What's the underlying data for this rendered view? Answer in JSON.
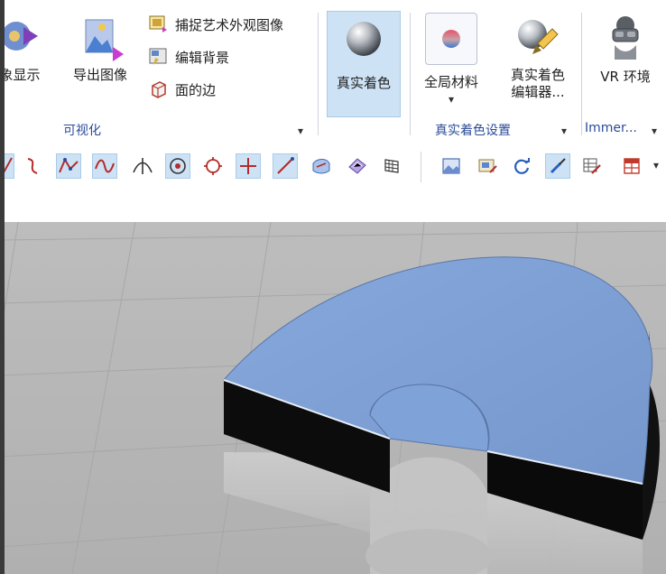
{
  "ribbon": {
    "left_button_partial_label": "象显示",
    "export_image_label": "导出图像",
    "capture_art_label": "捕捉艺术外观图像",
    "edit_background_label": "编辑背景",
    "face_edge_label": "面的边",
    "group_visualize_label": "可视化",
    "true_shading_label": "真实着色",
    "global_material_label": "全局材料",
    "true_shading_editor_label_line1": "真实着色",
    "true_shading_editor_label_line2": "编辑器...",
    "group_true_shading_settings_label": "真实着色设置",
    "vr_env_label": "VR 环境",
    "group_immersive_label": "Immer...",
    "dropdown_glyph": "▾"
  },
  "toolbar": {
    "icons": [
      "curve-partial-icon",
      "s-curve-icon",
      "polyline-icon",
      "spline-icon",
      "intersection-point-icon",
      "point-on-target-icon",
      "circle-center-icon",
      "crosshair-icon",
      "line-pencil-icon",
      "surface-icon",
      "pattern-face-icon",
      "grid-face-icon",
      "view-photo-icon",
      "image-edit-icon",
      "refresh-cycle-icon",
      "brush-select-icon",
      "table-edit-icon",
      "layout-grid-icon"
    ],
    "more_glyph": "▾"
  },
  "colors": {
    "accent": "#2b4c9a",
    "selected_bg": "#cde3f5",
    "part_top": "#7e9fd1",
    "viewport_bg": "#b7b7b7"
  }
}
